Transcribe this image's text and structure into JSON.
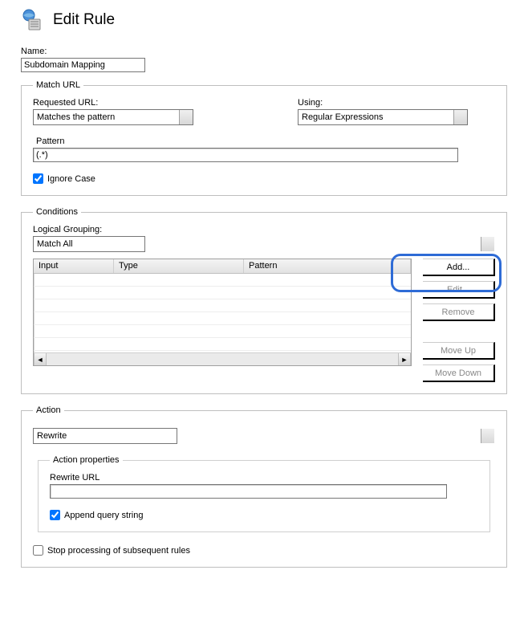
{
  "header": {
    "title": "Edit Rule"
  },
  "name": {
    "label": "Name:",
    "value": "Subdomain Mapping"
  },
  "match_url": {
    "legend": "Match URL",
    "requested_url": {
      "label": "Requested URL:",
      "value": "Matches the pattern"
    },
    "using": {
      "label": "Using:",
      "value": "Regular Expressions"
    },
    "pattern": {
      "label": "Pattern",
      "value": "(.*)"
    },
    "ignore_case": {
      "label": "Ignore Case",
      "checked": true
    }
  },
  "conditions": {
    "legend": "Conditions",
    "logical_grouping": {
      "label": "Logical Grouping:",
      "value": "Match All"
    },
    "columns": {
      "input": "Input",
      "type": "Type",
      "pattern": "Pattern"
    },
    "buttons": {
      "add": "Add...",
      "edit": "Edit...",
      "remove": "Remove",
      "move_up": "Move Up",
      "move_down": "Move Down"
    }
  },
  "action": {
    "legend": "Action",
    "type": {
      "value": "Rewrite"
    },
    "properties_legend": "Action properties",
    "rewrite_url": {
      "label": "Rewrite URL",
      "value": ""
    },
    "append_query": {
      "label": "Append query string",
      "checked": true
    },
    "stop_processing": {
      "label": "Stop processing of subsequent rules",
      "checked": false
    }
  }
}
